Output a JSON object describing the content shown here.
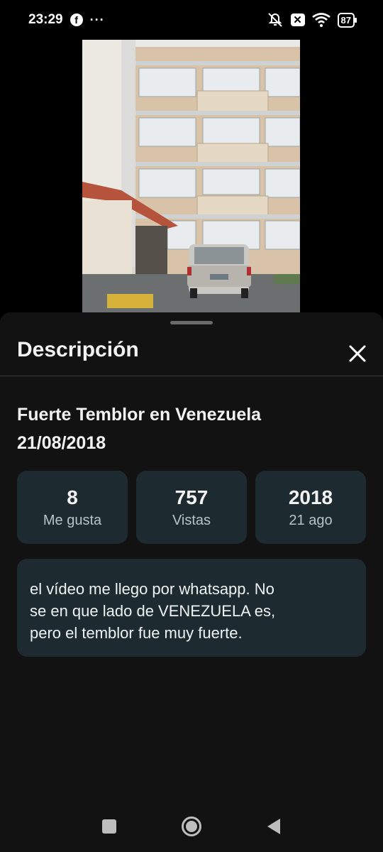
{
  "status_bar": {
    "time": "23:29",
    "notification_icon": "facebook-icon",
    "more_dots": "···",
    "icons": [
      "mute-vibrate-icon",
      "close-box-icon",
      "wifi-icon"
    ],
    "battery": "87",
    "x_label": "✕"
  },
  "video": {
    "icon": "video-frame-building"
  },
  "sheet": {
    "title": "Descripción",
    "close_icon": "close-icon",
    "video_title_line1": "Fuerte Temblor en Venezuela",
    "video_title_line2": "21/08/2018",
    "stats": [
      {
        "value": "8",
        "label": "Me gusta"
      },
      {
        "value": "757",
        "label": "Vistas"
      },
      {
        "value": "2018",
        "label": "21 ago"
      }
    ],
    "description_line1": "el vídeo me llego por whatsapp. No",
    "description_line2": "se en que lado de VENEZUELA es,",
    "description_line3": "pero el temblor fue muy fuerte."
  },
  "nav_bar": {
    "icons": [
      "recents-square-icon",
      "home-circle-icon",
      "back-triangle-icon"
    ]
  },
  "colors": {
    "background": "#000000",
    "sheet": "#121212",
    "card": "#1d2b31"
  }
}
